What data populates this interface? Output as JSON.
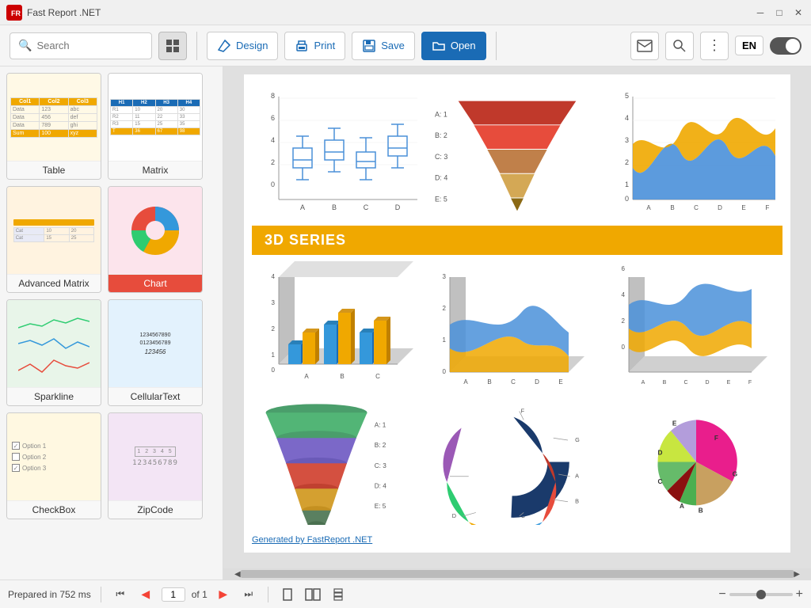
{
  "titlebar": {
    "logo": "FR",
    "title": "Fast Report .NET",
    "controls": [
      "minimize",
      "maximize",
      "close"
    ]
  },
  "toolbar": {
    "search_placeholder": "Search",
    "design_label": "Design",
    "print_label": "Print",
    "save_label": "Save",
    "open_label": "Open",
    "language": "EN"
  },
  "sidebar": {
    "items": [
      {
        "id": "table",
        "label": "Table",
        "active": false
      },
      {
        "id": "matrix",
        "label": "Matrix",
        "active": false
      },
      {
        "id": "advanced-matrix",
        "label": "Advanced Matrix",
        "active": false
      },
      {
        "id": "chart",
        "label": "Chart",
        "active": true
      },
      {
        "id": "sparkline",
        "label": "Sparkline",
        "active": false
      },
      {
        "id": "cellulartext",
        "label": "CellularText",
        "active": false
      },
      {
        "id": "checkbox",
        "label": "CheckBox",
        "active": false
      },
      {
        "id": "zipcode",
        "label": "ZipCode",
        "active": false
      }
    ]
  },
  "preview": {
    "section_3d": "3D SERIES",
    "generated_link": "Generated by FastReport .NET",
    "funnel_labels_1": [
      "A: 1",
      "B: 2",
      "C: 3",
      "D: 4",
      "E: 5"
    ],
    "funnel_labels_2": [
      "A: 1",
      "B: 2",
      "C: 3",
      "D: 4",
      "E: 5"
    ],
    "funnel_labels_3": [
      "F",
      "G",
      "A",
      "B",
      "C"
    ]
  },
  "statusbar": {
    "prepared_text": "Prepared in 752 ms",
    "page_current": "1",
    "page_of": "of 1"
  },
  "pagination": {
    "first_label": "⏮",
    "prev_label": "◀",
    "next_label": "▶",
    "last_label": "⏭"
  }
}
